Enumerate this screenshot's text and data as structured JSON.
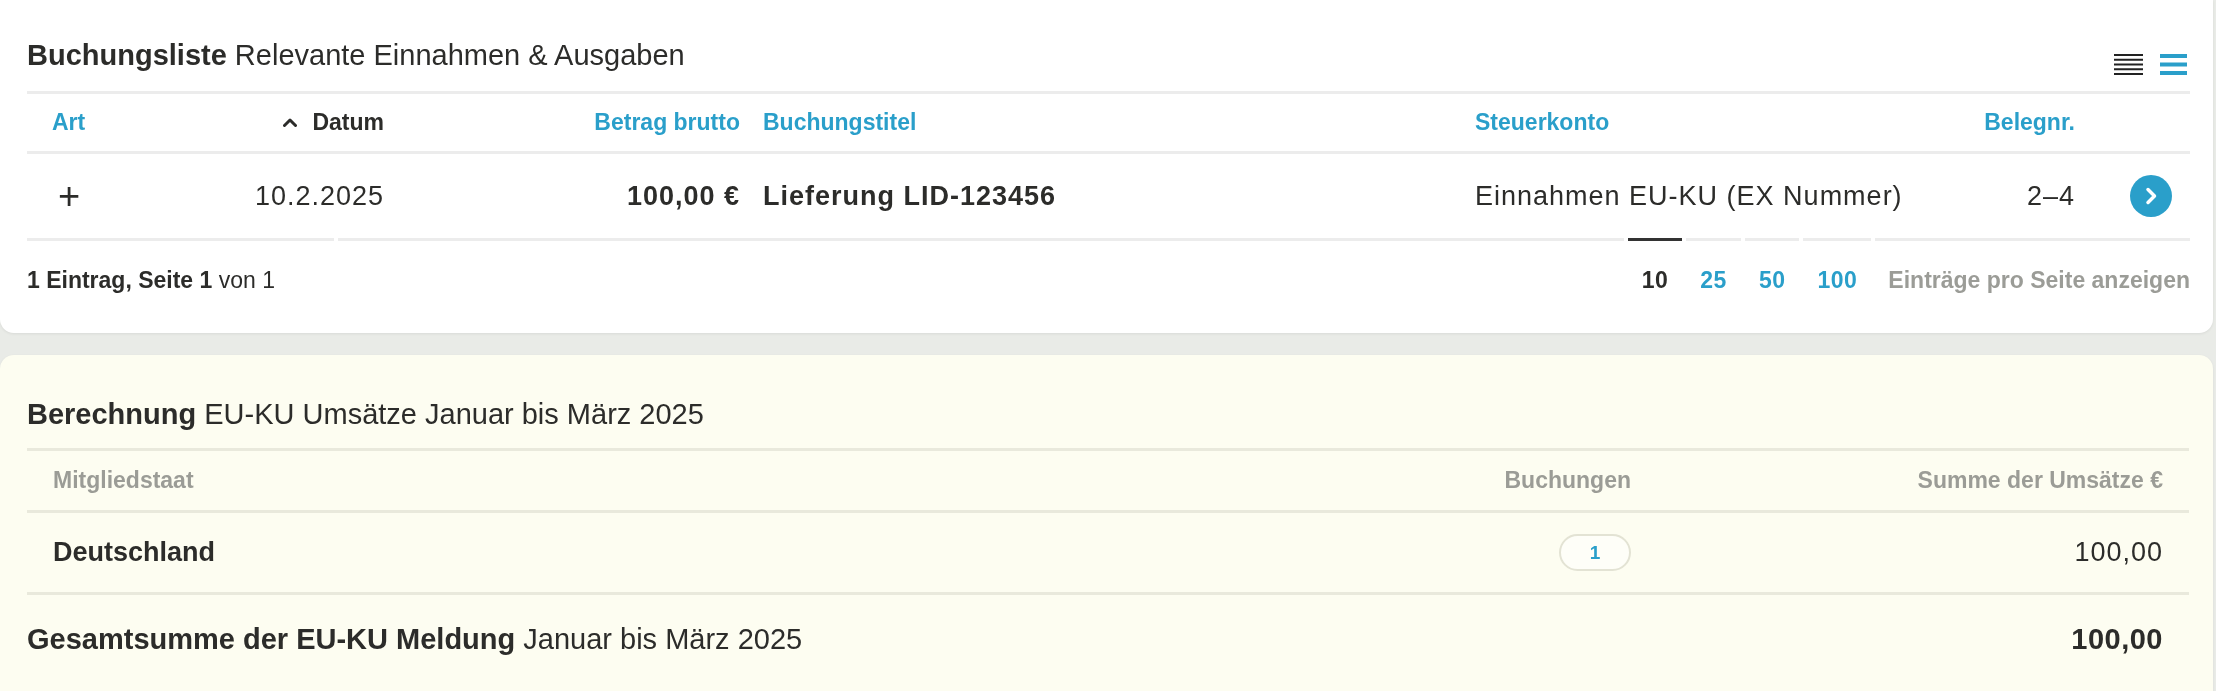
{
  "booking_list": {
    "title": "**Buchungsliste** Relevante Einnahmen & Ausgaben",
    "view_modes": [
      {
        "kind": "dense",
        "selected": false
      },
      {
        "kind": "normal",
        "selected": true
      }
    ],
    "columns": [
      {
        "label": "Art",
        "sorted": false
      },
      {
        "label": "Datum",
        "sorted": true
      },
      {
        "label": "Betrag brutto",
        "sorted": false
      },
      {
        "label": "Buchungstitel",
        "sorted": false
      },
      {
        "label": "Steuerkonto",
        "sorted": false
      },
      {
        "label": "Belegnr.",
        "sorted": false
      }
    ],
    "rows": [
      {
        "type": "+",
        "date": "10.2.2025",
        "gross_amount": "100,00 €",
        "title": "Lieferung LID-123456",
        "tax_account": "Einnahmen EU-KU (EX Nummer)",
        "receipt_number": "2–4"
      }
    ],
    "summary": "**1 Eintrag, Seite 1** von 1",
    "page_sizes": [
      {
        "label": "10",
        "selected": true
      },
      {
        "label": "25",
        "selected": false
      },
      {
        "label": "50",
        "selected": false
      },
      {
        "label": "100",
        "selected": false
      }
    ],
    "page_size_label": "Einträge pro Seite anzeigen"
  },
  "calculation": {
    "title": "**Berechnung** EU-KU Umsätze Januar bis März 2025",
    "columns": [
      "Mitgliedstaat",
      "Buchungen",
      "Summe der Umsätze €"
    ],
    "rows": [
      {
        "country": "Deutschland",
        "bookings": "1",
        "sum": "100,00"
      }
    ],
    "total": {
      "label": "**Gesamtsumme der EU-KU Meldung** Januar bis März 2025",
      "sum": "100,00"
    }
  }
}
